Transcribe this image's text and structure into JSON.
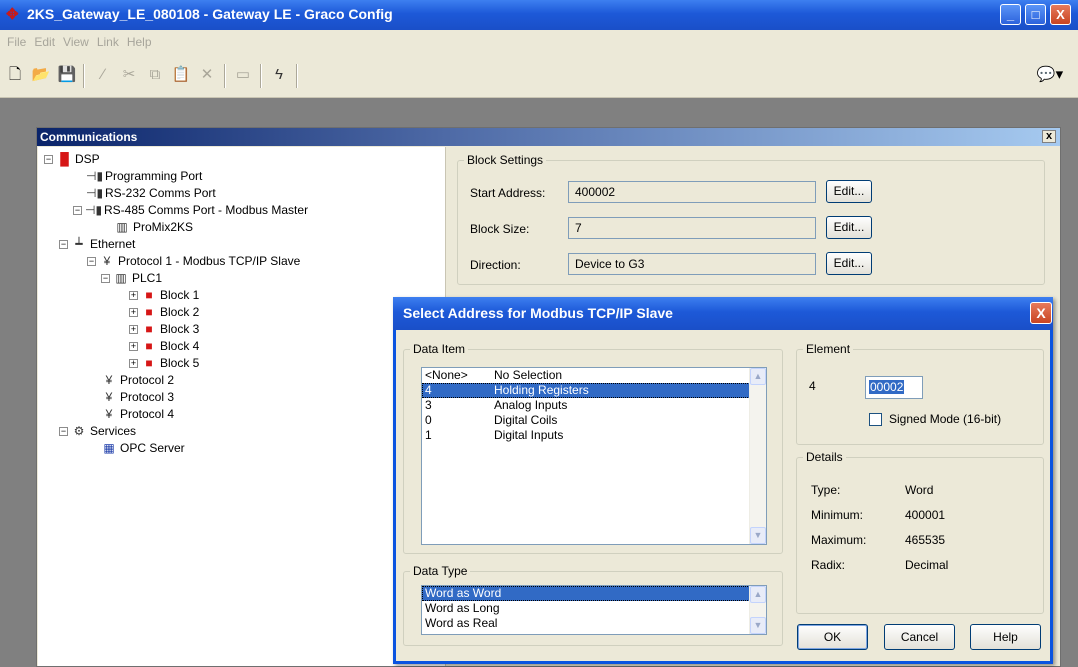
{
  "window": {
    "title": "2KS_Gateway_LE_080108 - Gateway LE - Graco Config",
    "minimize": "_",
    "maximize": "□",
    "close": "X"
  },
  "menu": [
    "File",
    "Edit",
    "View",
    "Link",
    "Help"
  ],
  "toolbar": {
    "icons": [
      "new-icon",
      "open-icon",
      "save-icon",
      "edit-pencil-icon",
      "cut-icon",
      "copy-icon",
      "paste-icon",
      "delete-icon",
      "frame-icon",
      "lightning-icon",
      "comment-icon"
    ]
  },
  "communications": {
    "title": "Communications",
    "close": "x",
    "tree": [
      {
        "label": "DSP",
        "expander": "−"
      },
      {
        "label": "Programming Port"
      },
      {
        "label": "RS-232 Comms Port"
      },
      {
        "label": "RS-485 Comms Port - Modbus Master",
        "expander": "−"
      },
      {
        "label": "ProMix2KS"
      },
      {
        "label": "Ethernet",
        "expander": "−"
      },
      {
        "label": "Protocol 1 - Modbus TCP/IP Slave",
        "expander": "−"
      },
      {
        "label": "PLC1",
        "expander": "−"
      },
      {
        "label": "Block 1",
        "expander": "+"
      },
      {
        "label": "Block 2",
        "expander": "+"
      },
      {
        "label": "Block 3",
        "expander": "+"
      },
      {
        "label": "Block 4",
        "expander": "+"
      },
      {
        "label": "Block 5",
        "expander": "+"
      },
      {
        "label": "Protocol 2"
      },
      {
        "label": "Protocol 3"
      },
      {
        "label": "Protocol 4"
      },
      {
        "label": "Services",
        "expander": "−"
      },
      {
        "label": "OPC Server"
      }
    ]
  },
  "block_settings": {
    "title": "Block Settings",
    "start_address": {
      "label": "Start Address:",
      "value": "400002"
    },
    "block_size": {
      "label": "Block Size:",
      "value": "7"
    },
    "direction": {
      "label": "Direction:",
      "value": "Device to G3"
    },
    "edit_label": "Edit..."
  },
  "dialog": {
    "title": "Select Address for Modbus TCP/IP Slave",
    "close": "X",
    "data_item": {
      "title": "Data Item",
      "rows": [
        {
          "code": "<None>",
          "name": "No Selection"
        },
        {
          "code": "4",
          "name": "Holding Registers"
        },
        {
          "code": "3",
          "name": "Analog Inputs"
        },
        {
          "code": "0",
          "name": "Digital Coils"
        },
        {
          "code": "1",
          "name": "Digital Inputs"
        }
      ],
      "selected_index": 1
    },
    "data_type": {
      "title": "Data Type",
      "rows": [
        "Word as Word",
        "Word as Long",
        "Word as Real"
      ],
      "selected_index": 0
    },
    "element": {
      "title": "Element",
      "prefix": "4",
      "value": "00002",
      "signed_mode_label": "Signed Mode (16-bit)",
      "signed_mode_checked": false
    },
    "details": {
      "title": "Details",
      "type": {
        "label": "Type:",
        "value": "Word"
      },
      "minimum": {
        "label": "Minimum:",
        "value": "400001"
      },
      "maximum": {
        "label": "Maximum:",
        "value": "465535"
      },
      "radix": {
        "label": "Radix:",
        "value": "Decimal"
      }
    },
    "buttons": {
      "ok": "OK",
      "cancel": "Cancel",
      "help": "Help"
    }
  }
}
